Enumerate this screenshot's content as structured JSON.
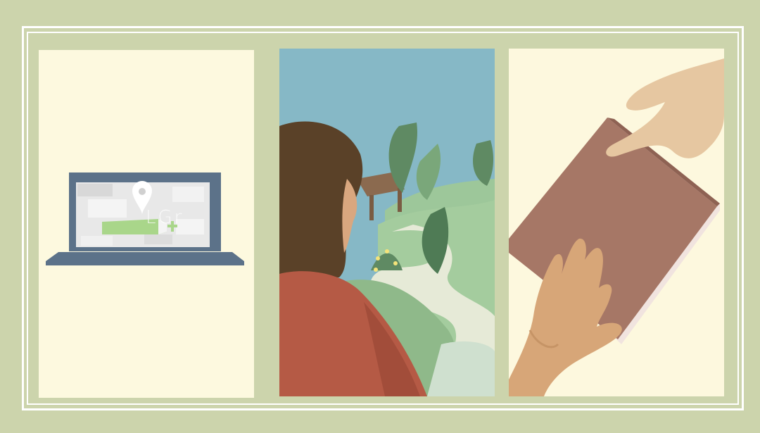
{
  "laptop_panel": {
    "screen_text": "LGr"
  },
  "icons": [
    "location-pin-icon",
    "plus-icon"
  ],
  "colors": {
    "background": "#ccd4ac",
    "frame": "#ffffff",
    "panel_cream": "#fdf9df",
    "sky": "#86b8c6",
    "laptop": "#5c7289",
    "book": "#a67766",
    "sweater": "#b55a45",
    "hair": "#5a4128",
    "skin": "#e6c7a1"
  }
}
